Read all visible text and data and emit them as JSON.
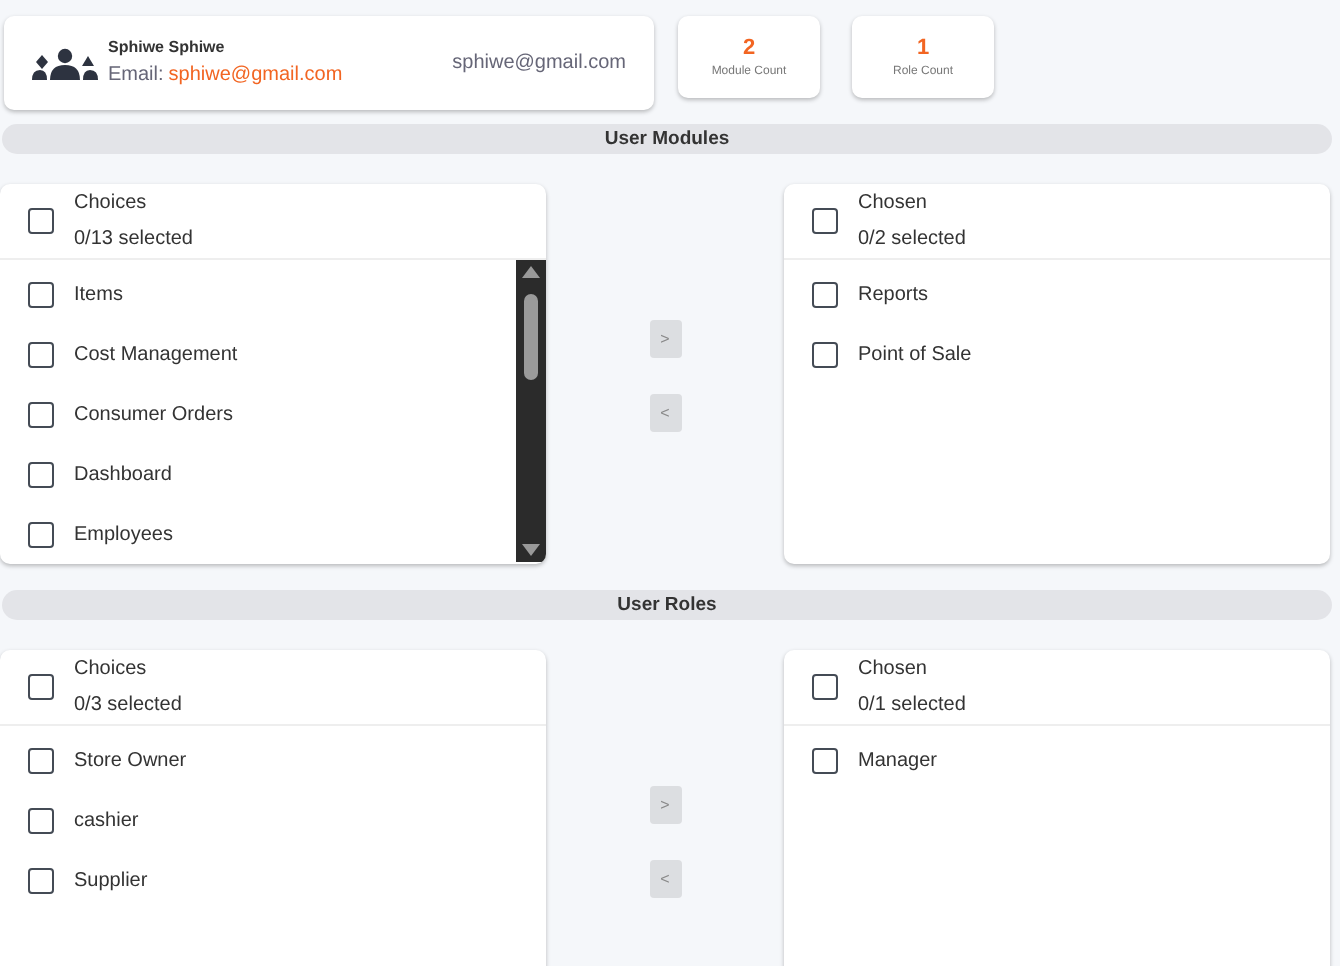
{
  "profile": {
    "name": "Sphiwe Sphiwe",
    "email_label": "Email:",
    "email": "sphiwe@gmail.com",
    "email_right": "sphiwe@gmail.com"
  },
  "counts": [
    {
      "value": "2",
      "label": "Module Count"
    },
    {
      "value": "1",
      "label": "Role Count"
    }
  ],
  "sections": [
    {
      "title": "User Modules",
      "scrollbar": true,
      "choices": {
        "title": "Choices",
        "summary": "0/13 selected",
        "checked": false,
        "items": [
          {
            "label": "Items",
            "checked": false
          },
          {
            "label": "Cost Management",
            "checked": false
          },
          {
            "label": "Consumer Orders",
            "checked": false
          },
          {
            "label": "Dashboard",
            "checked": false
          },
          {
            "label": "Employees",
            "checked": false
          }
        ]
      },
      "move_buttons": [
        {
          "label": ">",
          "disabled": true
        },
        {
          "label": "<",
          "disabled": true
        }
      ],
      "chosen": {
        "title": "Chosen",
        "summary": "0/2 selected",
        "checked": false,
        "items": [
          {
            "label": "Reports",
            "checked": false
          },
          {
            "label": "Point of Sale",
            "checked": false
          }
        ]
      }
    },
    {
      "title": "User Roles",
      "scrollbar": false,
      "choices": {
        "title": "Choices",
        "summary": "0/3 selected",
        "checked": false,
        "items": [
          {
            "label": "Store Owner",
            "checked": false
          },
          {
            "label": "cashier",
            "checked": false
          },
          {
            "label": "Supplier",
            "checked": false
          }
        ]
      },
      "move_buttons": [
        {
          "label": ">",
          "disabled": true
        },
        {
          "label": "<",
          "disabled": true
        }
      ],
      "chosen": {
        "title": "Chosen",
        "summary": "0/1 selected",
        "checked": false,
        "items": [
          {
            "label": "Manager",
            "checked": false
          }
        ]
      }
    }
  ]
}
